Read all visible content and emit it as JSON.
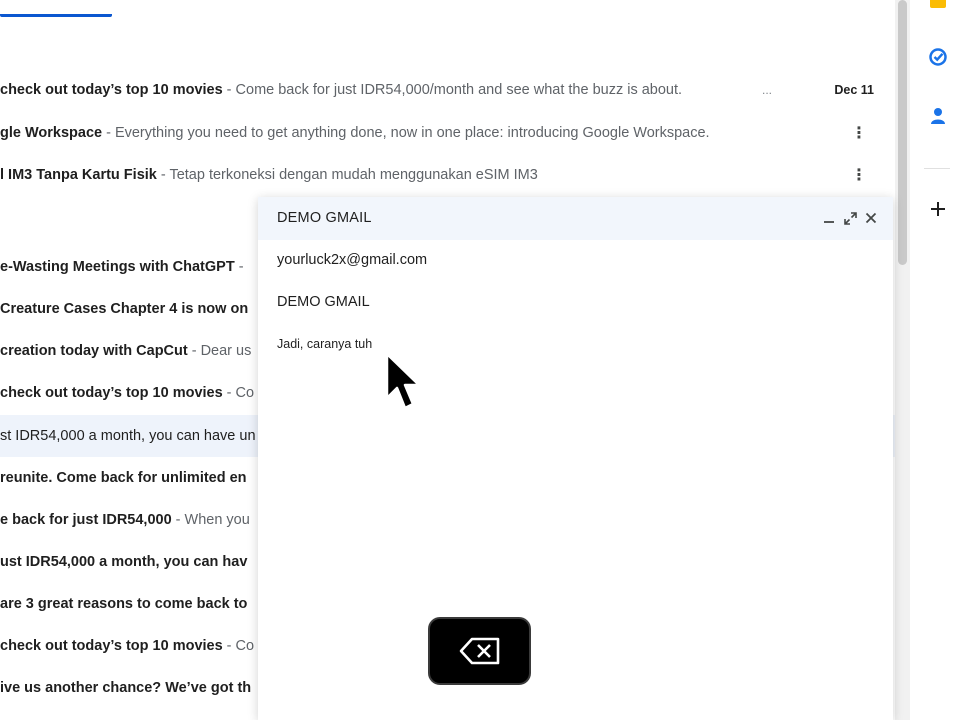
{
  "inbox": {
    "rows": [
      {
        "subject": "check out today’s top 10 movies",
        "snippet": "- Come back for just IDR54,000/month and see what the buzz is about.",
        "date": "Dec 11",
        "ellipsis": "..."
      },
      {
        "subject": "gle Workspace",
        "snippet": "- Everything you need to get anything done, now in one place: introducing Google Workspace."
      },
      {
        "subject": "l IM3 Tanpa Kartu Fisik",
        "snippet": "- Tetap terkoneksi dengan mudah menggunakan eSIM IM3"
      },
      {
        "subject": "e-Wasting Meetings with ChatGPT",
        "snippet": "-"
      },
      {
        "subject": "Creature Cases Chapter 4 is now on",
        "snippet": ""
      },
      {
        "subject": "creation today with CapCut",
        "snippet": "- Dear us"
      },
      {
        "subject": "check out today’s top 10 movies",
        "snippet": "- Co"
      },
      {
        "subject": "",
        "snippet": "st IDR54,000 a month, you can have un"
      },
      {
        "subject": "reunite. Come back for unlimited en",
        "snippet": ""
      },
      {
        "subject": "e back for just IDR54,000",
        "snippet": "- When you"
      },
      {
        "subject": "ust IDR54,000 a month, you can hav",
        "snippet": ""
      },
      {
        "subject": "are 3 great reasons to come back to",
        "snippet": ""
      },
      {
        "subject": "check out today’s top 10 movies",
        "snippet": "- Co"
      },
      {
        "subject": "ive us another chance? We’ve got th",
        "snippet": ""
      }
    ],
    "more_icon": "more-vert-icon"
  },
  "side_rail": {
    "icons": [
      "keep-icon",
      "tasks-icon",
      "contacts-icon",
      "add-icon"
    ]
  },
  "compose": {
    "title": "DEMO GMAIL",
    "to": "yourluck2x@gmail.com",
    "subject": "DEMO GMAIL",
    "body": "Jadi, caranya tuh"
  },
  "overlay": {
    "key_icon": "backspace-icon"
  },
  "colors": {
    "accent": "#0b57d0",
    "compose_header_bg": "#f2f6fc",
    "selected_row_bg": "#eef3fb",
    "keep_yellow": "#fbbc04",
    "tasks_blue": "#1a73e8"
  }
}
